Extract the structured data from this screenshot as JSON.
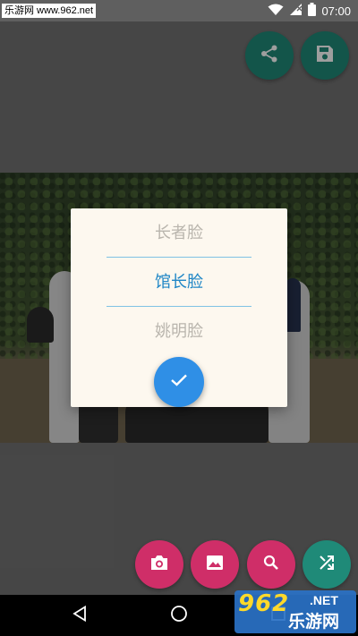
{
  "status_bar": {
    "watermark": "乐游网 www.962.net",
    "time": "07:00",
    "icons": [
      "wifi-icon",
      "signal-icon",
      "battery-icon"
    ]
  },
  "top_actions": [
    {
      "name": "share-icon",
      "color": "#1f8a78"
    },
    {
      "name": "save-icon",
      "color": "#1f8a78"
    }
  ],
  "dialog": {
    "options": [
      {
        "label": "长者脸",
        "selected": false
      },
      {
        "label": "馆长脸",
        "selected": true
      },
      {
        "label": "姚明脸",
        "selected": false
      }
    ],
    "confirm_icon": "check-icon",
    "accent_color": "#1f86c6",
    "confirm_color": "#2f8fe6"
  },
  "bottom_actions": [
    {
      "name": "camera-icon",
      "color": "#cf2e68"
    },
    {
      "name": "image-icon",
      "color": "#cf2e68"
    },
    {
      "name": "search-icon",
      "color": "#cf2e68"
    },
    {
      "name": "shuffle-icon",
      "color": "#1f8a78"
    }
  ],
  "nav_bar": {
    "icons": [
      "back-icon",
      "home-icon",
      "recents-icon"
    ]
  },
  "site_logo": {
    "number": "962",
    "net": ".NET",
    "cn": "乐游网"
  }
}
